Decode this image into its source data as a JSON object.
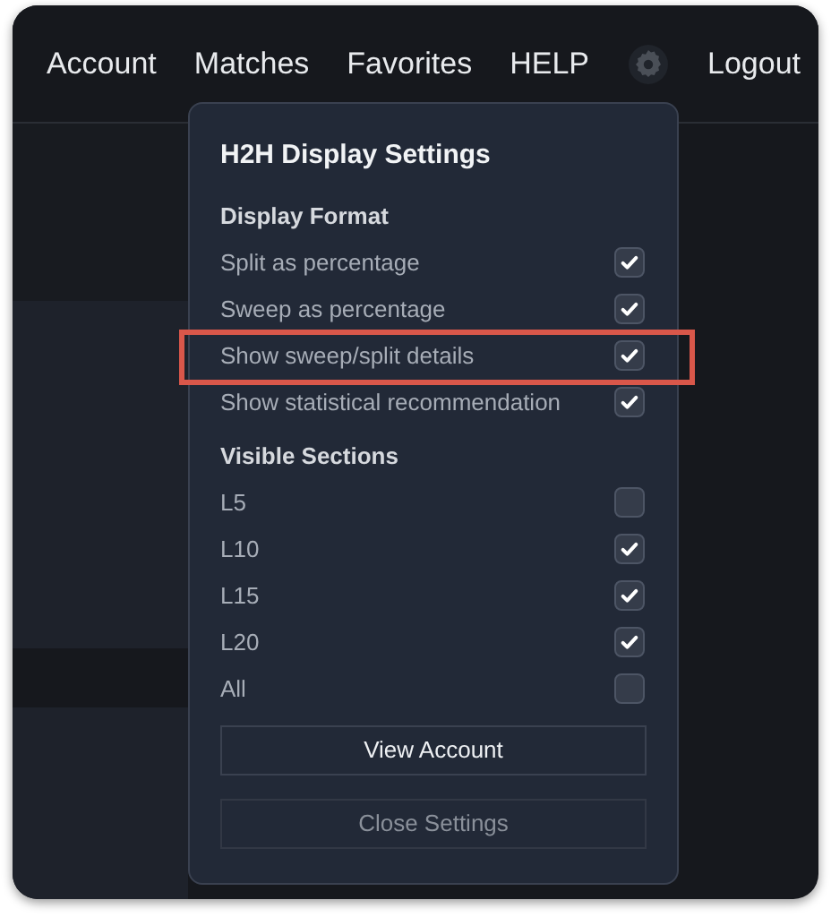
{
  "nav": {
    "items": [
      {
        "label": "Account"
      },
      {
        "label": "Matches"
      },
      {
        "label": "Favorites"
      },
      {
        "label": "HELP"
      },
      {
        "kind": "gear"
      },
      {
        "label": "Logout"
      }
    ]
  },
  "settings_panel": {
    "title": "H2H Display Settings",
    "sections": [
      {
        "heading": "Display Format",
        "options": [
          {
            "label": "Split as percentage",
            "checked": true,
            "highlighted": false
          },
          {
            "label": "Sweep as percentage",
            "checked": true,
            "highlighted": false
          },
          {
            "label": "Show sweep/split details",
            "checked": true,
            "highlighted": true
          },
          {
            "label": "Show statistical recommendation",
            "checked": true,
            "highlighted": false
          }
        ]
      },
      {
        "heading": "Visible Sections",
        "options": [
          {
            "label": "L5",
            "checked": false,
            "highlighted": false
          },
          {
            "label": "L10",
            "checked": true,
            "highlighted": false
          },
          {
            "label": "L15",
            "checked": true,
            "highlighted": false
          },
          {
            "label": "L20",
            "checked": true,
            "highlighted": false
          },
          {
            "label": "All",
            "checked": false,
            "highlighted": false
          }
        ]
      }
    ],
    "buttons": [
      {
        "label": "View Account",
        "disabled": false
      },
      {
        "label": "Close Settings",
        "disabled": true
      }
    ]
  }
}
